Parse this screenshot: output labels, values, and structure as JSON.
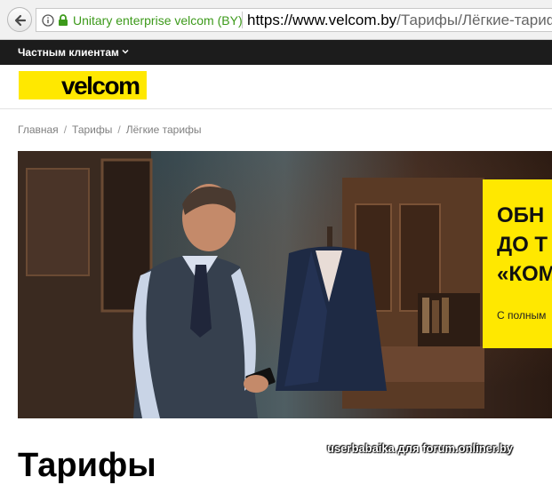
{
  "browser": {
    "identity": "Unitary enterprise velcom (BY)",
    "url_host": "https://www.velcom.by",
    "url_path": "/Тарифы/Лёгкие-тарифы"
  },
  "site": {
    "nav_item": "Частным клиентам",
    "logo_text": "velcom",
    "brand_color": "#ffe800"
  },
  "breadcrumb": {
    "items": [
      "Главная",
      "Тарифы",
      "Лёгкие тарифы"
    ],
    "separator": "/"
  },
  "hero": {
    "promo_title": "ОБН\nДО Т\n«КОМ",
    "promo_subtitle": "С полным"
  },
  "page": {
    "heading": "Тарифы"
  },
  "watermark": "userbabaika для forum.onliner.by",
  "icons": [
    "back-arrow-icon",
    "info-icon",
    "lock-icon",
    "chevron-down-icon"
  ]
}
